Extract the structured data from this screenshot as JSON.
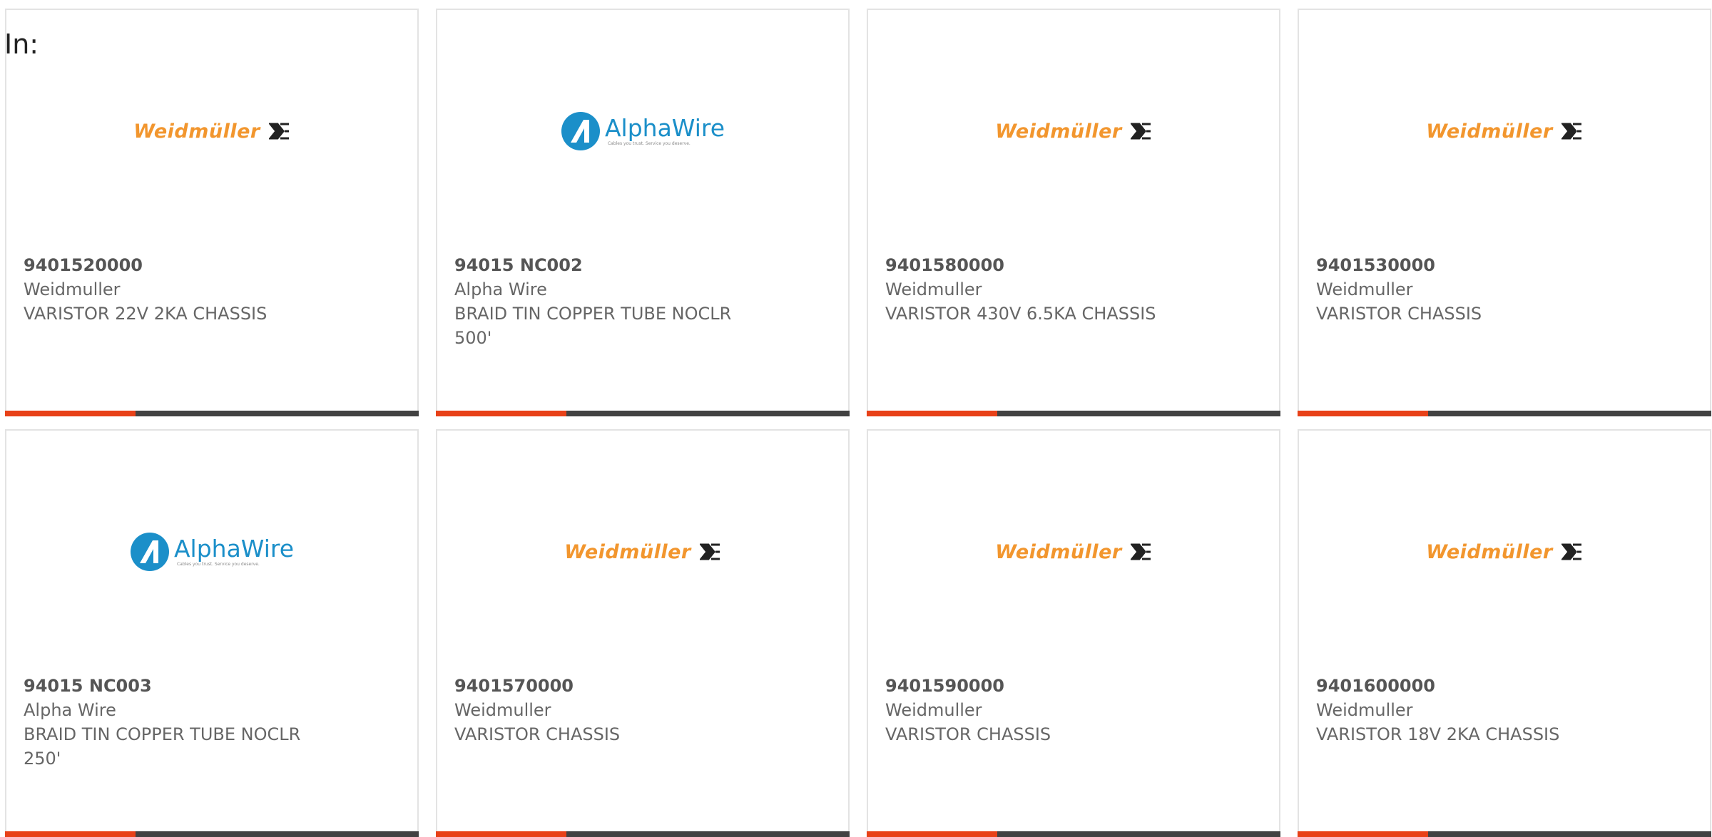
{
  "filter_label": "In:",
  "colors": {
    "accent_bar": "#e84118",
    "dark_bar": "#424242",
    "weidmuller_orange": "#f2962e",
    "alphawire_blue": "#1b8fc9"
  },
  "products": [
    {
      "part_number": "9401520000",
      "manufacturer": "Weidmuller",
      "description": "VARISTOR 22V 2KA CHASSIS",
      "logo": {
        "type": "weidmuller",
        "text": "Weidmüller"
      }
    },
    {
      "part_number": "94015 NC002",
      "manufacturer": "Alpha Wire",
      "description": "BRAID TIN COPPER TUBE NOCLR 500'",
      "logo": {
        "type": "alphawire",
        "text": "AlphaWire",
        "tagline": "Cables you trust. Service you deserve."
      }
    },
    {
      "part_number": "9401580000",
      "manufacturer": "Weidmuller",
      "description": "VARISTOR 430V 6.5KA CHASSIS",
      "logo": {
        "type": "weidmuller",
        "text": "Weidmüller"
      }
    },
    {
      "part_number": "9401530000",
      "manufacturer": "Weidmuller",
      "description": "VARISTOR CHASSIS",
      "logo": {
        "type": "weidmuller",
        "text": "Weidmüller"
      }
    },
    {
      "part_number": "94015 NC003",
      "manufacturer": "Alpha Wire",
      "description": "BRAID TIN COPPER TUBE NOCLR 250'",
      "logo": {
        "type": "alphawire",
        "text": "AlphaWire",
        "tagline": "Cables you trust. Service you deserve."
      }
    },
    {
      "part_number": "9401570000",
      "manufacturer": "Weidmuller",
      "description": "VARISTOR CHASSIS",
      "logo": {
        "type": "weidmuller",
        "text": "Weidmüller"
      }
    },
    {
      "part_number": "9401590000",
      "manufacturer": "Weidmuller",
      "description": "VARISTOR CHASSIS",
      "logo": {
        "type": "weidmuller",
        "text": "Weidmüller"
      }
    },
    {
      "part_number": "9401600000",
      "manufacturer": "Weidmuller",
      "description": "VARISTOR 18V 2KA CHASSIS",
      "logo": {
        "type": "weidmuller",
        "text": "Weidmüller"
      }
    }
  ]
}
